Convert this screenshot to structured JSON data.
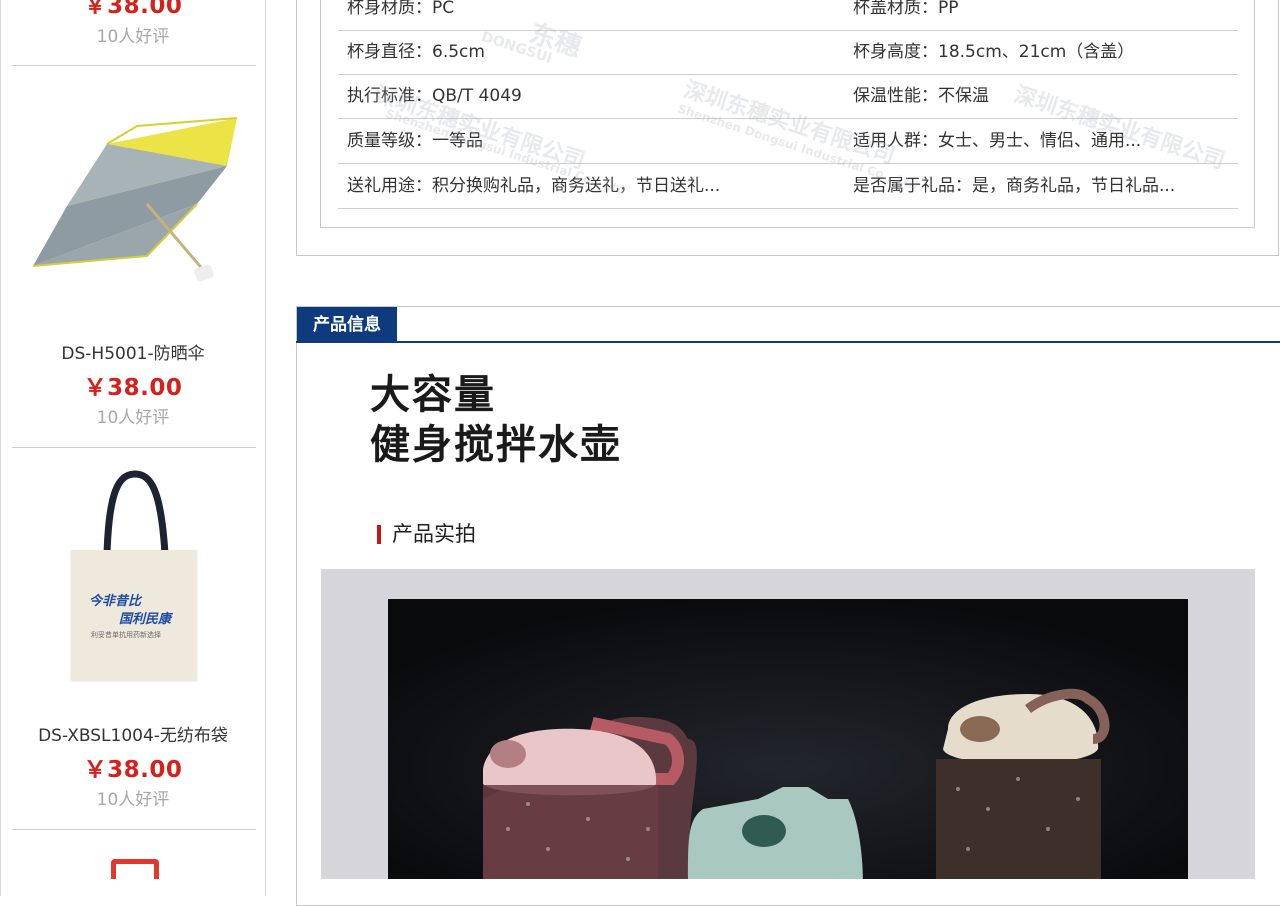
{
  "sidebar": {
    "items": [
      {
        "price": "￥38.00",
        "reviews": "10人好评"
      },
      {
        "name": "DS-H5001-防晒伞",
        "price": "￥38.00",
        "reviews": "10人好评"
      },
      {
        "name": "DS-XBSL1004-无纺布袋",
        "price": "￥38.00",
        "reviews": "10人好评"
      }
    ],
    "bag_print": {
      "line1": "今非昔比",
      "line2": "国利民康",
      "line3": "利妥昔单抗用药新选择"
    }
  },
  "specs": {
    "rows": [
      {
        "left": "杯身材质：PC",
        "right": "杯盖材质：PP"
      },
      {
        "left": "杯身直径：6.5cm",
        "right": "杯身高度：18.5cm、21cm（含盖）"
      },
      {
        "left": "执行标准：QB/T 4049",
        "right": "保温性能：不保温"
      },
      {
        "left": "质量等级：一等品",
        "right": "适用人群：女士、男士、情侣、通用..."
      },
      {
        "left": "送礼用途：积分换购礼品，商务送礼，节日送礼...",
        "right": "是否属于礼品：是，商务礼品，节日礼品..."
      }
    ],
    "watermark": {
      "cn": "深圳东穗实业有限公司",
      "en": "Shenzhen Dongsui Industrial Co., Ltd",
      "brand": "东穗",
      "brand_en": "DONGSUI"
    }
  },
  "product_info": {
    "tab_label": "产品信息",
    "headline_line1": "大容量",
    "headline_line2": "健身搅拌水壶",
    "section_title": "产品实拍"
  },
  "colors": {
    "price_red": "#d6201b",
    "tab_blue": "#0d3b7d",
    "accent_red": "#c8141b"
  }
}
